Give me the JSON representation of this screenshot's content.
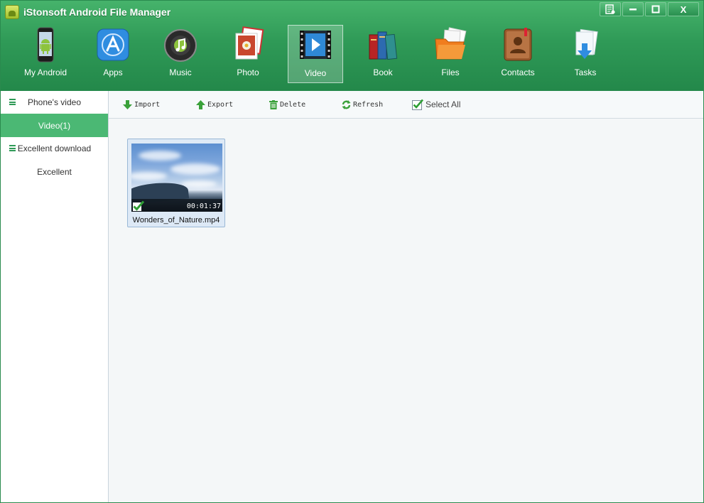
{
  "app": {
    "title": "iStonsoft Android File Manager"
  },
  "window_controls": {
    "menu": "≡",
    "minimize": "—",
    "maximize": "□",
    "close": "X"
  },
  "nav": {
    "active": "Video",
    "items": [
      {
        "label": "My Android",
        "icon": "android-phone-icon"
      },
      {
        "label": "Apps",
        "icon": "app-store-icon"
      },
      {
        "label": "Music",
        "icon": "music-disc-icon"
      },
      {
        "label": "Photo",
        "icon": "photo-icon"
      },
      {
        "label": "Video",
        "icon": "video-film-icon"
      },
      {
        "label": "Book",
        "icon": "books-icon"
      },
      {
        "label": "Files",
        "icon": "folder-icon"
      },
      {
        "label": "Contacts",
        "icon": "contacts-book-icon"
      },
      {
        "label": "Tasks",
        "icon": "tasks-download-icon"
      }
    ]
  },
  "sidebar": {
    "groups": [
      {
        "label": "Phone's video",
        "items": [
          {
            "label": "Video(1)",
            "active": true
          }
        ]
      },
      {
        "label": "Excellent download",
        "items": [
          {
            "label": "Excellent",
            "active": false
          }
        ]
      }
    ]
  },
  "toolbar": {
    "import": "Import",
    "export": "Export",
    "delete": "Delete",
    "refresh": "Refresh",
    "select_all": "Select All",
    "select_all_checked": true
  },
  "files": [
    {
      "name": "Wonders_of_Nature.mp4",
      "duration": "00:01:37",
      "selected": true
    }
  ],
  "colors": {
    "header": "#2f9a57",
    "active_item": "#4bb874",
    "accent": "#3aa85f"
  }
}
